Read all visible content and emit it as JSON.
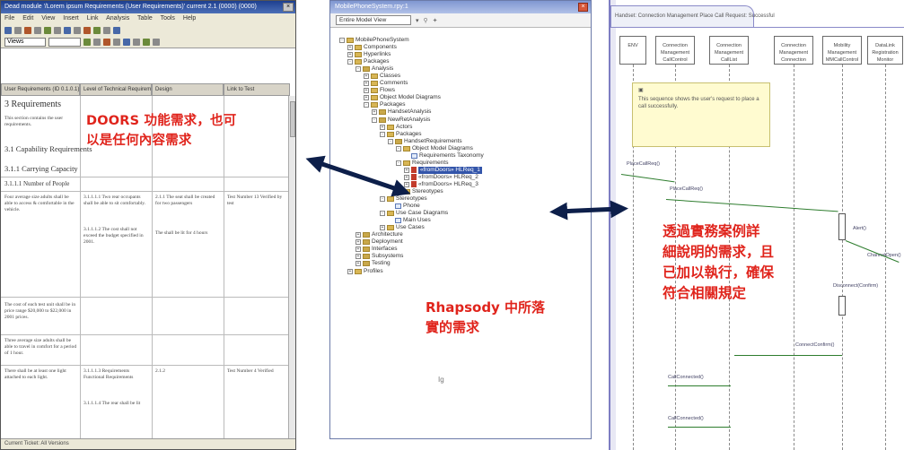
{
  "doors_window": {
    "title": "Dead module '/Lorem ipsum Requirements (User Requirements)' current 2.1 (0000) (0000)",
    "menu": [
      "File",
      "Edit",
      "View",
      "Insert",
      "Link",
      "Analysis",
      "Table",
      "Tools",
      "Help"
    ],
    "view_combo": "Views",
    "columns": [
      "User Requirements (ID 0.1.0.1)",
      "Level of Technical Requirement",
      "Design",
      "Link to Test"
    ],
    "headings": [
      "3 Requirements",
      "3.1 Capability Requirements",
      "3.1.1 Carrying Capacity",
      "3.1.1.1 Number of People"
    ],
    "intro_text": "This section contains the user requirements.",
    "body_rows": [
      "Four average size adults shall be able to access & comfortable in the vehicle.",
      "The cost of each test unit shall be in price range $20,000 to $22,000 in 2001 prices.",
      "Three average size adults shall be able to travel in comfort for a period of 1 hour.",
      "There shall be at least one light attached to each light."
    ],
    "tech_rows": [
      "3.1.1.1.1 Two rear occupants shall be able to sit comfortably.",
      "3.1.1.1.2 The cost shall not exceed the budget specified in 2001.",
      "3.1.1.1.3 Requirements Functional Requirements",
      "3.1.1.1.4 The rear shall be lit"
    ],
    "design_rows": [
      "2.1.1 The seat shall be created for two passengers",
      "The shall be lit for 4 hours",
      "2.1.2"
    ],
    "test_rows": [
      "Test Number 13 Verified by test",
      "Test Number 4 Verified"
    ],
    "status": "Current Ticket: All Versions"
  },
  "rhapsody_window": {
    "title": "MobilePhoneSystem.rpy:1",
    "view_select": "Entire Model View",
    "tree": [
      {
        "label": "MobilePhoneSystem",
        "depth": 0,
        "icon": "project-icon",
        "sign": "-"
      },
      {
        "label": "Components",
        "depth": 1,
        "icon": "folder-icon",
        "sign": "+"
      },
      {
        "label": "Hyperlinks",
        "depth": 1,
        "icon": "folder-icon",
        "sign": "+"
      },
      {
        "label": "Packages",
        "depth": 1,
        "icon": "folder-icon",
        "sign": "-"
      },
      {
        "label": "Analysis",
        "depth": 2,
        "icon": "package-icon",
        "sign": "-"
      },
      {
        "label": "Classes",
        "depth": 3,
        "icon": "folder-icon",
        "sign": "+"
      },
      {
        "label": "Comments",
        "depth": 3,
        "icon": "folder-icon",
        "sign": "+"
      },
      {
        "label": "Flows",
        "depth": 3,
        "icon": "folder-icon",
        "sign": "+"
      },
      {
        "label": "Object Model Diagrams",
        "depth": 3,
        "icon": "folder-icon",
        "sign": "+"
      },
      {
        "label": "Packages",
        "depth": 3,
        "icon": "folder-icon",
        "sign": "-"
      },
      {
        "label": "HandsetAnalysis",
        "depth": 4,
        "icon": "package-icon",
        "sign": "+"
      },
      {
        "label": "NewRetAnalysis",
        "depth": 4,
        "icon": "package-icon",
        "sign": "-"
      },
      {
        "label": "Actors",
        "depth": 5,
        "icon": "folder-icon",
        "sign": "+"
      },
      {
        "label": "Packages",
        "depth": 5,
        "icon": "folder-icon",
        "sign": "-"
      },
      {
        "label": "HandsetRequirements",
        "depth": 6,
        "icon": "package-icon",
        "sign": "-"
      },
      {
        "label": "Object Model Diagrams",
        "depth": 7,
        "icon": "folder-icon",
        "sign": "-"
      },
      {
        "label": "Requirements Taxonomy",
        "depth": 8,
        "icon": "diagram-icon",
        "sign": ""
      },
      {
        "label": "Requirements",
        "depth": 7,
        "icon": "folder-icon",
        "sign": "-"
      },
      {
        "label": "«fromDoors» HLReq_1",
        "depth": 8,
        "icon": "requirement-icon",
        "sign": "+",
        "selected": true
      },
      {
        "label": "«fromDoors» HLReq_2",
        "depth": 8,
        "icon": "requirement-icon",
        "sign": "+"
      },
      {
        "label": "«fromDoors» HLReq_3",
        "depth": 8,
        "icon": "requirement-icon",
        "sign": "+"
      },
      {
        "label": "Stereotypes",
        "depth": 7,
        "icon": "folder-icon",
        "sign": "+"
      },
      {
        "label": "Stereotypes",
        "depth": 5,
        "icon": "folder-icon",
        "sign": "-"
      },
      {
        "label": "Phone",
        "depth": 6,
        "icon": "diagram-icon",
        "sign": ""
      },
      {
        "label": "Use Case Diagrams",
        "depth": 5,
        "icon": "folder-icon",
        "sign": "-"
      },
      {
        "label": "Main Uses",
        "depth": 6,
        "icon": "diagram-icon",
        "sign": ""
      },
      {
        "label": "Use Cases",
        "depth": 5,
        "icon": "folder-icon",
        "sign": "+"
      },
      {
        "label": "Architecture",
        "depth": 2,
        "icon": "package-icon",
        "sign": "+"
      },
      {
        "label": "Deployment",
        "depth": 2,
        "icon": "package-icon",
        "sign": "+"
      },
      {
        "label": "Interfaces",
        "depth": 2,
        "icon": "package-icon",
        "sign": "+"
      },
      {
        "label": "Subsystems",
        "depth": 2,
        "icon": "package-icon",
        "sign": "+"
      },
      {
        "label": "Testing",
        "depth": 2,
        "icon": "package-icon",
        "sign": "+"
      },
      {
        "label": "Profiles",
        "depth": 1,
        "icon": "folder-icon",
        "sign": "+"
      }
    ],
    "cursor_glyph": "Ig"
  },
  "sequence_diagram": {
    "tab_title": "Handset: Connection Management Place Call Request: Successful",
    "lifelines": [
      "ENV",
      "Connection Management CallControl",
      "Connection Management CallList",
      "Connection Management Connection",
      "Mobility Management MMCallControl",
      "DataLink Registration Monitor"
    ],
    "note_text": "This sequence shows the user's request to place a call successfully.",
    "messages": [
      "PlaceCallReq()",
      "PlaceCallReq()",
      "Alert()",
      "ChannelOpen()",
      "Disconnect(Confirm)",
      "ConnectConfirm()",
      "CallConnected()",
      "CallConnected()"
    ]
  },
  "captions": {
    "doors": [
      "DOORS 功能需求，也可",
      "以是任何內容需求"
    ],
    "rhapsody": [
      "Rhapsody 中所落",
      "實的需求"
    ],
    "right": [
      "透過實務案例詳",
      "細說明的需求，且",
      "已加以執行，確保",
      "符合相關規定"
    ]
  },
  "colors": {
    "caption": "#e0241c",
    "arrow": "#0d1f4a",
    "doors_title": "#1d3f8f",
    "rhapsody_frame": "#6b7aa8",
    "message_line": "#2e7d2e"
  }
}
